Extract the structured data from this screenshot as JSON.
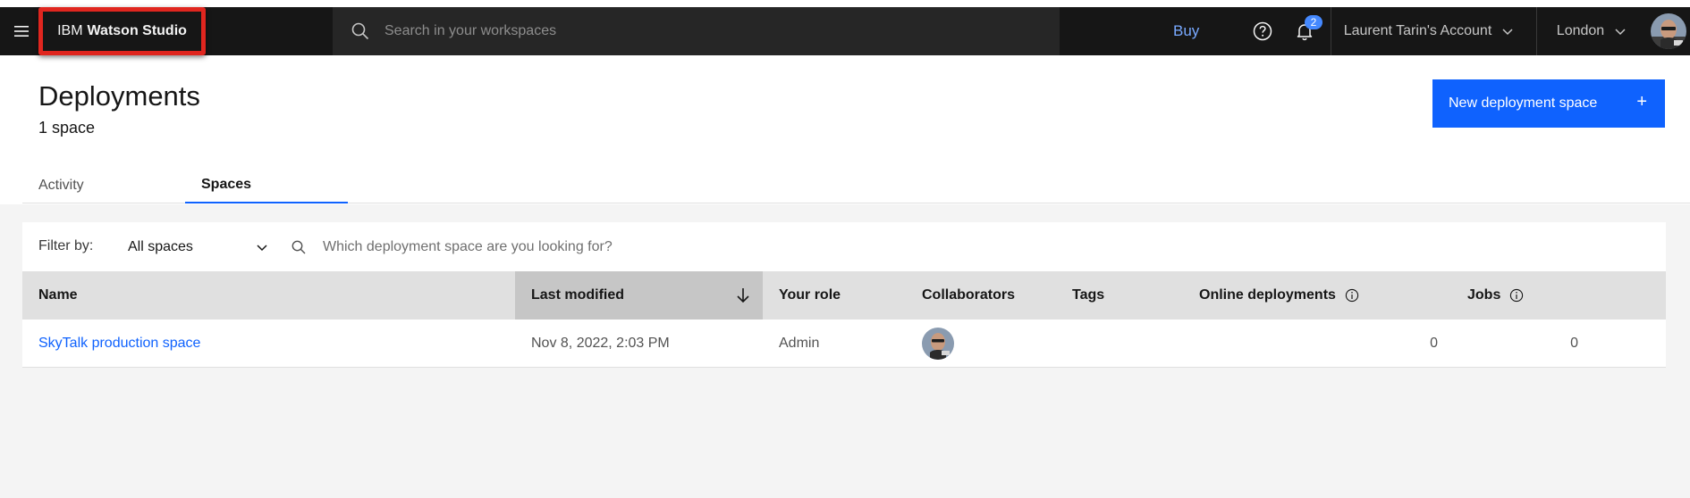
{
  "topbar": {
    "brand_prefix": "IBM",
    "brand_product": "Watson Studio",
    "search_placeholder": "Search in your workspaces",
    "buy_label": "Buy",
    "notification_count": "2",
    "account_label": "Laurent Tarin's Account",
    "region_label": "London",
    "icons": [
      "hamburger-menu-icon",
      "search-icon",
      "help-icon",
      "notification-icon",
      "chevron-down-icon",
      "avatar"
    ]
  },
  "page": {
    "title": "Deployments",
    "subtitle": "1 space",
    "new_space_label": "New deployment space",
    "new_space_icon": "+"
  },
  "tabs": [
    {
      "label": "Activity",
      "active": false
    },
    {
      "label": "Spaces",
      "active": true
    }
  ],
  "filter": {
    "label": "Filter by:",
    "selected": "All spaces",
    "search_placeholder": "Which deployment space are you looking for?"
  },
  "table": {
    "columns": [
      "Name",
      "Last modified",
      "Your role",
      "Collaborators",
      "Tags",
      "Online deployments",
      "Jobs"
    ],
    "sorted_column": "Last modified",
    "sort_direction": "descending",
    "rows": [
      {
        "name": "SkyTalk production space",
        "last_modified": "Nov 8, 2022, 2:03 PM",
        "role": "Admin",
        "collaborators": [
          "avatar"
        ],
        "tags": "",
        "online_deployments": "0",
        "jobs": "0"
      }
    ]
  },
  "colors": {
    "topbar_bg": "#161616",
    "primary": "#0f62fe",
    "link": "#0f62fe",
    "buy_link": "#78a9ff",
    "highlight_border": "#e0261f",
    "badge": "#4589ff"
  }
}
